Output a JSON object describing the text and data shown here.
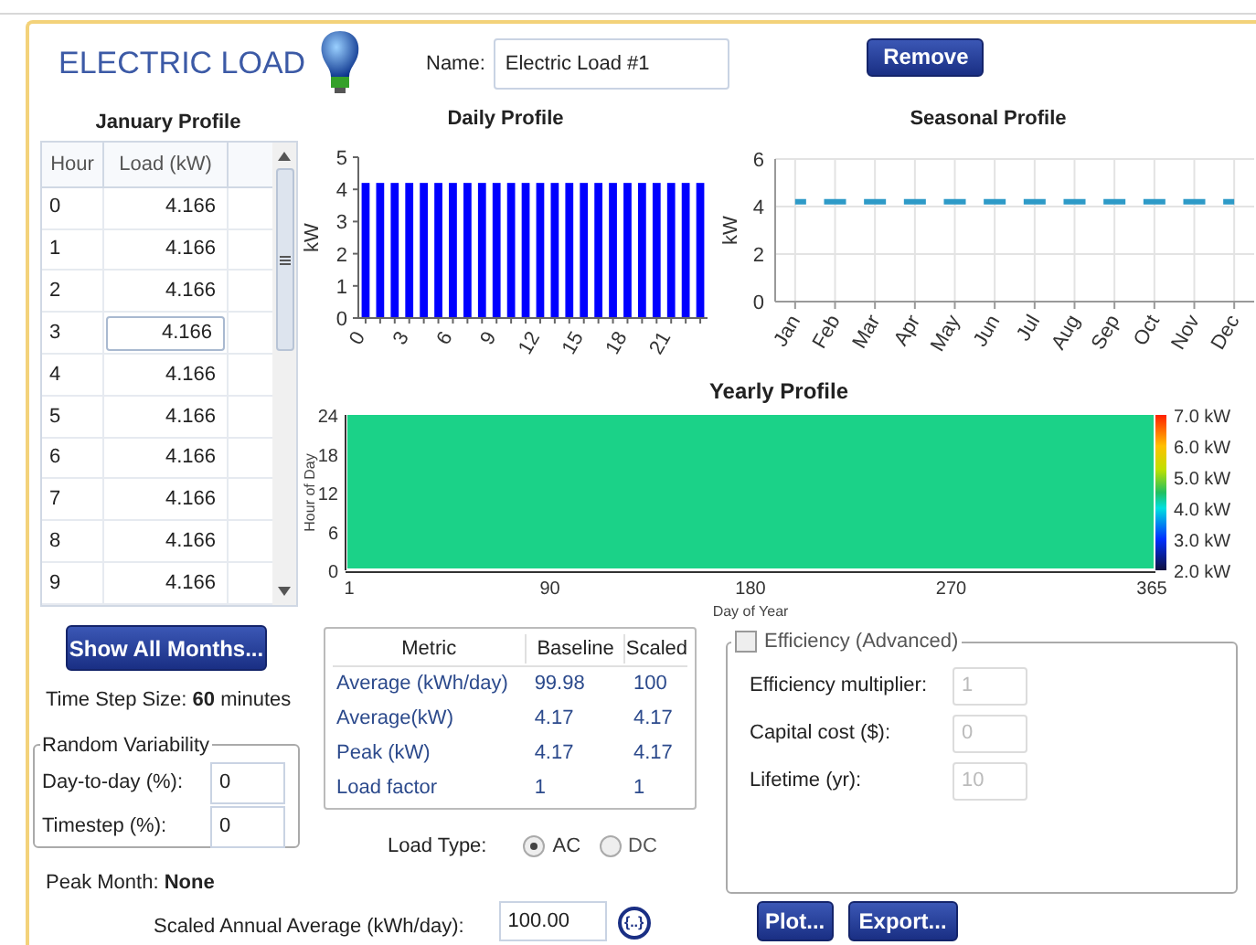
{
  "header": {
    "title": "ELECTRIC LOAD",
    "name_label": "Name:",
    "name_value": "Electric Load #1",
    "remove_button": "Remove"
  },
  "january_profile": {
    "title": "January Profile",
    "columns": [
      "Hour",
      "Load (kW)"
    ],
    "rows": [
      {
        "hour": "0",
        "load": "4.166",
        "selected": false
      },
      {
        "hour": "1",
        "load": "4.166",
        "selected": false
      },
      {
        "hour": "2",
        "load": "4.166",
        "selected": false
      },
      {
        "hour": "3",
        "load": "4.166",
        "selected": true
      },
      {
        "hour": "4",
        "load": "4.166",
        "selected": false
      },
      {
        "hour": "5",
        "load": "4.166",
        "selected": false
      },
      {
        "hour": "6",
        "load": "4.166",
        "selected": false
      },
      {
        "hour": "7",
        "load": "4.166",
        "selected": false
      },
      {
        "hour": "8",
        "load": "4.166",
        "selected": false
      },
      {
        "hour": "9",
        "load": "4.166",
        "selected": false
      }
    ]
  },
  "show_all_months_button": "Show All Months...",
  "time_step": "Time Step Size: **60** minutes",
  "random_variability": {
    "title": "Random Variability",
    "fields": [
      {
        "label": "Day-to-day (%):",
        "value": "0"
      },
      {
        "label": "Timestep (%):",
        "value": "0"
      }
    ]
  },
  "peak_month": "Peak Month: **None**",
  "daily_profile": {
    "chart_data": {
      "type": "bar",
      "title": "Daily Profile",
      "ylabel": "kW",
      "x": [
        0,
        1,
        2,
        3,
        4,
        5,
        6,
        7,
        8,
        9,
        10,
        11,
        12,
        13,
        14,
        15,
        16,
        17,
        18,
        19,
        20,
        21,
        22,
        23
      ],
      "series": [
        {
          "color": "#0000ff",
          "values": [
            4.2,
            4.2,
            4.2,
            4.2,
            4.2,
            4.2,
            4.2,
            4.2,
            4.2,
            4.2,
            4.2,
            4.2,
            4.2,
            4.2,
            4.2,
            4.2,
            4.2,
            4.2,
            4.2,
            4.2,
            4.2,
            4.2,
            4.2,
            4.2
          ]
        }
      ],
      "xlim": [
        -0.5,
        23.5
      ],
      "ylim": [
        0,
        5
      ],
      "yticks": [
        0,
        1,
        2,
        3,
        4,
        5
      ],
      "xticks": [
        0,
        3,
        6,
        9,
        12,
        15,
        18,
        21
      ]
    }
  },
  "seasonal_profile": {
    "chart_data": {
      "type": "line",
      "title": "Seasonal Profile",
      "ylabel": "kW",
      "categories": [
        "Jan",
        "Feb",
        "Mar",
        "Apr",
        "May",
        "Jun",
        "Jul",
        "Aug",
        "Sep",
        "Oct",
        "Nov",
        "Dec"
      ],
      "series": [
        {
          "color": "#2e9ac7",
          "line_style": "dashed",
          "values": [
            4.2,
            4.2,
            4.2,
            4.2,
            4.2,
            4.2,
            4.2,
            4.2,
            4.2,
            4.2,
            4.2,
            4.2
          ]
        }
      ],
      "ylim": [
        0,
        6
      ],
      "yticks": [
        0,
        2,
        4,
        6
      ],
      "grid": true
    }
  },
  "yearly_profile": {
    "title": "Yearly Profile",
    "ylabel": "Hour of Day",
    "xlabel": "Day of Year",
    "yticks": [
      "24",
      "18",
      "12",
      "6",
      "0"
    ],
    "xticks": [
      "1",
      "90",
      "180",
      "270",
      "365"
    ],
    "legend": [
      "7.0 kW",
      "6.0 kW",
      "5.0 kW",
      "4.0 kW",
      "3.0 kW",
      "2.0 kW"
    ]
  },
  "metrics": {
    "columns": [
      "Metric",
      "Baseline",
      "Scaled"
    ],
    "rows": [
      [
        "Average (kWh/day)",
        "99.98",
        "100"
      ],
      [
        "Average(kW)",
        "4.17",
        "4.17"
      ],
      [
        "Peak (kW)",
        "4.17",
        "4.17"
      ],
      [
        "Load factor",
        "1",
        "1"
      ]
    ]
  },
  "load_type": {
    "label": "Load Type:",
    "options": [
      {
        "label": "AC",
        "selected": true
      },
      {
        "label": "DC",
        "selected": false
      }
    ]
  },
  "efficiency": {
    "title": "Efficiency (Advanced)",
    "checked": false,
    "fields": [
      {
        "label": "Efficiency multiplier:",
        "value": "1"
      },
      {
        "label": "Capital cost ($):",
        "value": "0"
      },
      {
        "label": "Lifetime (yr):",
        "value": "10"
      }
    ]
  },
  "scaled_annual": {
    "label": "Scaled Annual Average (kWh/day):",
    "value": "100.00",
    "button": "{..}"
  },
  "buttons": [
    "Plot...",
    "Export..."
  ]
}
